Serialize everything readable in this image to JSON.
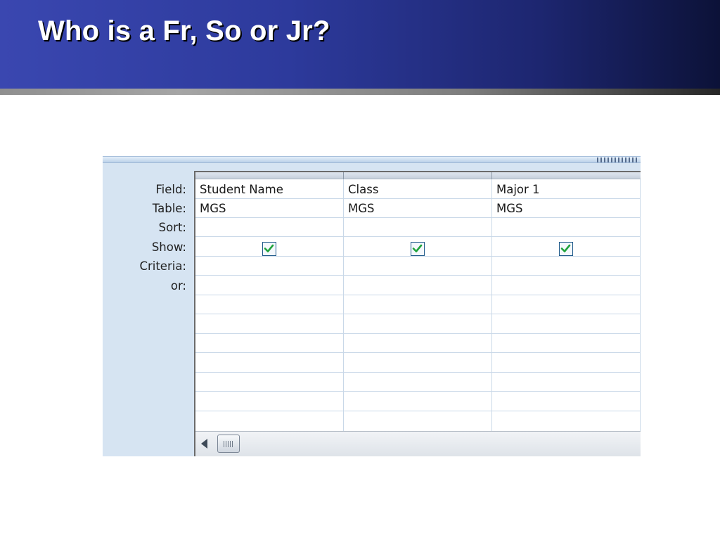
{
  "slide": {
    "title": "Who is a Fr, So or Jr?"
  },
  "query_grid": {
    "row_labels": {
      "field": "Field:",
      "table": "Table:",
      "sort": "Sort:",
      "show": "Show:",
      "criteria": "Criteria:",
      "or": "or:"
    },
    "columns": [
      {
        "field": "Student Name",
        "table": "MGS",
        "sort": "",
        "show": true,
        "criteria": "",
        "or": ""
      },
      {
        "field": "Class",
        "table": "MGS",
        "sort": "",
        "show": true,
        "criteria": "",
        "or": ""
      },
      {
        "field": "Major 1",
        "table": "MGS",
        "sort": "",
        "show": true,
        "criteria": "",
        "or": ""
      }
    ]
  },
  "colors": {
    "header_blue": "#2d3a9c",
    "checkmark_green": "#1fa33b",
    "checkbox_border": "#1f5a8a",
    "panel_background": "#d6e4f2"
  },
  "icons": {
    "show_checkbox": "checkmark-icon",
    "scroll_left": "left-arrow-icon",
    "scroll_thumb": "scroll-grip-icon"
  }
}
